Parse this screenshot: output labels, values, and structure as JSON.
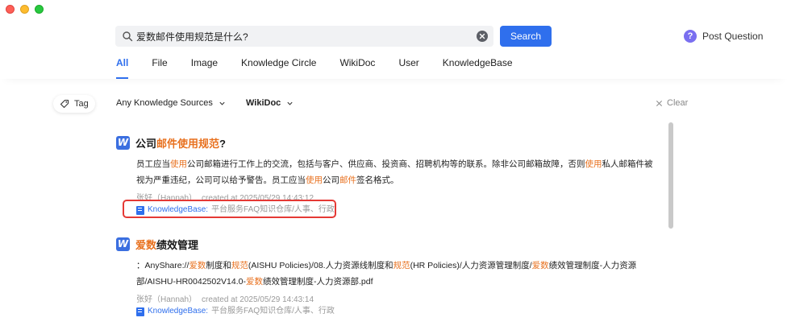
{
  "search": {
    "query": "爱数邮件使用规范是什么?",
    "button_label": "Search"
  },
  "header": {
    "post_question_label": "Post Question",
    "post_question_icon": "?"
  },
  "tabs": [
    {
      "label": "All",
      "active": true
    },
    {
      "label": "File",
      "active": false
    },
    {
      "label": "Image",
      "active": false
    },
    {
      "label": "Knowledge Circle",
      "active": false
    },
    {
      "label": "WikiDoc",
      "active": false
    },
    {
      "label": "User",
      "active": false
    },
    {
      "label": "KnowledgeBase",
      "active": false
    }
  ],
  "filters": {
    "tag_label": "Tag",
    "sources_label": "Any Knowledge Sources",
    "type_label": "WikiDoc",
    "clear_label": "Clear"
  },
  "results": [
    {
      "logo": "W",
      "title_parts": [
        {
          "text": "公司",
          "hl": false
        },
        {
          "text": "邮件使用规范",
          "hl": true
        },
        {
          "text": "?",
          "hl": false
        }
      ],
      "body_parts": [
        {
          "text": "员工应当",
          "hl": false
        },
        {
          "text": "使用",
          "hl": true
        },
        {
          "text": "公司邮箱进行工作上的交流，包括与客户、供应商、投资商、招聘机构等的联系。除非公司邮箱故障，否则",
          "hl": false
        },
        {
          "text": "使用",
          "hl": true
        },
        {
          "text": "私人邮箱件被视为严重违纪，公司可以给予警告。员工应当",
          "hl": false
        },
        {
          "text": "使用",
          "hl": true
        },
        {
          "text": "公司",
          "hl": false
        },
        {
          "text": "邮件",
          "hl": true
        },
        {
          "text": "签名格式。",
          "hl": false
        }
      ],
      "author": "张好（Hannah）",
      "created": "created at 2025/05/29 14:43:12",
      "source_kb": "KnowledgeBase:",
      "source_path": "平台服务FAQ知识仓库/人事、行政"
    },
    {
      "logo": "W",
      "title_parts": [
        {
          "text": "爱数",
          "hl": true
        },
        {
          "text": "绩效管理",
          "hl": false
        }
      ],
      "body_parts": [
        {
          "text": "：AnyShare://",
          "hl": false
        },
        {
          "text": "爱数",
          "hl": true
        },
        {
          "text": "制度和",
          "hl": false
        },
        {
          "text": "规范",
          "hl": true
        },
        {
          "text": "(AISHU Policies)/08.人力资源线制度和",
          "hl": false
        },
        {
          "text": "规范",
          "hl": true
        },
        {
          "text": "(HR Policies)/人力资源管理制度/",
          "hl": false
        },
        {
          "text": "爱数",
          "hl": true
        },
        {
          "text": "绩效管理制度-人力资源部/AISHU-HR0042502V14.0-",
          "hl": false
        },
        {
          "text": "爱数",
          "hl": true
        },
        {
          "text": "绩效管理制度-人力资源部.pdf",
          "hl": false
        }
      ],
      "author": "张好（Hannah）",
      "created": "created at 2025/05/29 14:43:14",
      "source_kb": "KnowledgeBase:",
      "source_path": "平台服务FAQ知识仓库/人事、行政"
    }
  ],
  "colors": {
    "accent": "#2f6fed",
    "highlight": "#e8711f",
    "annotation_box": "#e53935"
  }
}
